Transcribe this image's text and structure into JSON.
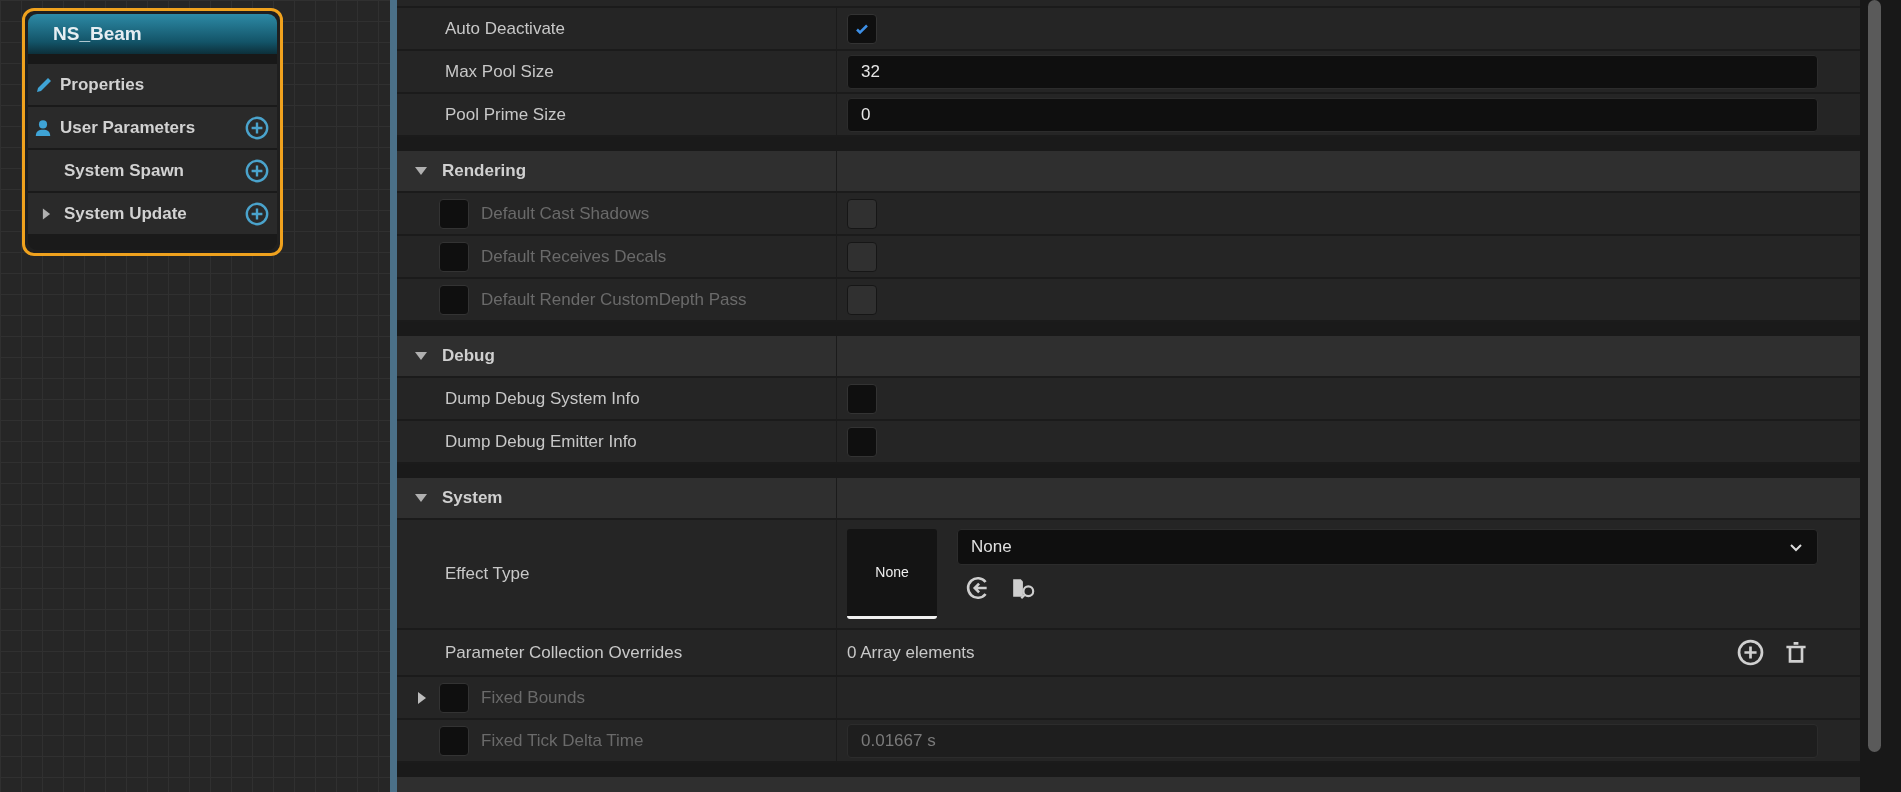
{
  "graph_node": {
    "title": "NS_Beam",
    "items": [
      {
        "kind": "properties",
        "label": "Properties",
        "add": false
      },
      {
        "kind": "parameters",
        "label": "User Parameters",
        "add": true
      },
      {
        "kind": "stage",
        "label": "System Spawn",
        "add": true
      },
      {
        "kind": "stage",
        "label": "System Update",
        "add": true,
        "expanded": false
      }
    ]
  },
  "details": {
    "top_rows": [
      {
        "kind": "checkbox",
        "label": "Auto Deactivate",
        "checked": true
      },
      {
        "kind": "number",
        "label": "Max Pool Size",
        "value": "32"
      },
      {
        "kind": "number",
        "label": "Pool Prime Size",
        "value": "0"
      }
    ],
    "sections": [
      {
        "title": "Rendering",
        "expanded": true,
        "rows": [
          {
            "kind": "checkbox",
            "label": "Default Cast Shadows",
            "condition_checked": false,
            "disabled": true,
            "checked": false
          },
          {
            "kind": "checkbox",
            "label": "Default Receives Decals",
            "condition_checked": false,
            "disabled": true,
            "checked": false
          },
          {
            "kind": "checkbox",
            "label": "Default Render CustomDepth Pass",
            "condition_checked": false,
            "disabled": true,
            "checked": false
          }
        ]
      },
      {
        "title": "Debug",
        "expanded": true,
        "rows": [
          {
            "kind": "checkbox",
            "label": "Dump Debug System Info",
            "checked": false
          },
          {
            "kind": "checkbox",
            "label": "Dump Debug Emitter Info",
            "checked": false
          }
        ]
      },
      {
        "title": "System",
        "expanded": true,
        "rows": [
          {
            "kind": "asset",
            "label": "Effect Type",
            "thumbnail": "None",
            "value": "None"
          },
          {
            "kind": "array",
            "label": "Parameter Collection Overrides",
            "value": "0 Array elements"
          },
          {
            "kind": "group",
            "label": "Fixed Bounds",
            "condition_checked": false,
            "disabled": true,
            "expanded": false
          },
          {
            "kind": "number",
            "label": "Fixed Tick Delta Time",
            "condition_checked": false,
            "disabled": true,
            "value": "0.01667 s"
          }
        ]
      }
    ]
  }
}
